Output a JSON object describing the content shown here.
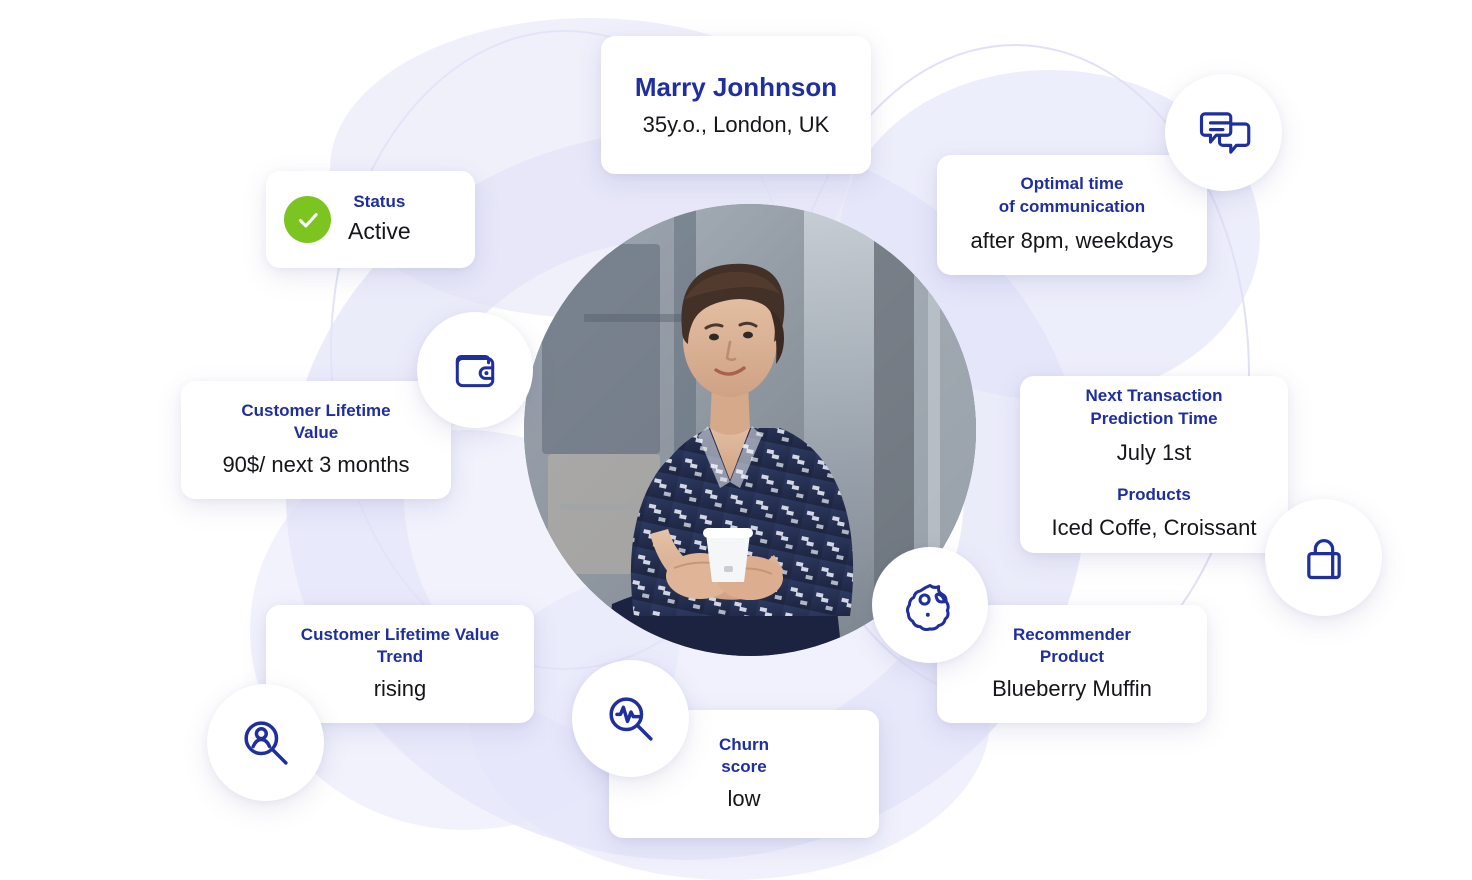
{
  "customer": {
    "name": "Marry Jonhnson",
    "details": "35y.o., London, UK"
  },
  "cards": {
    "status": {
      "label": "Status",
      "value": "Active",
      "badge_color": "#7cc520",
      "badge_icon": "check-icon"
    },
    "communication": {
      "label": "Optimal time\nof communication",
      "value": "after 8pm, weekdays"
    },
    "clv": {
      "label": "Customer Lifetime\nValue",
      "value": "90$/ next 3 months"
    },
    "next_transaction": {
      "label": "Next Transaction\nPrediction Time",
      "value": "July 1st",
      "label2": "Products",
      "value2": "Iced Coffe, Croissant"
    },
    "clv_trend": {
      "label": "Customer Lifetime Value\nTrend",
      "value": "rising"
    },
    "recommender": {
      "label": "Recommender\nProduct",
      "value": "Blueberry Muffin"
    },
    "churn": {
      "label": "Churn\nscore",
      "value": "low"
    }
  },
  "icons": {
    "chat": "chat-bubbles-icon",
    "wallet": "wallet-icon",
    "lock": "lock-icon",
    "cookie": "cookie-icon",
    "pulse_search": "pulse-search-icon",
    "person_search": "person-search-icon"
  },
  "colors": {
    "accent_blue": "#1f2f9e",
    "text_dark": "#15161a",
    "status_green": "#7cc520",
    "background_lavender": "#e1e2f8",
    "card_white": "#ffffff"
  },
  "portrait": {
    "alt": "Portrait of a woman holding a coffee cup"
  }
}
